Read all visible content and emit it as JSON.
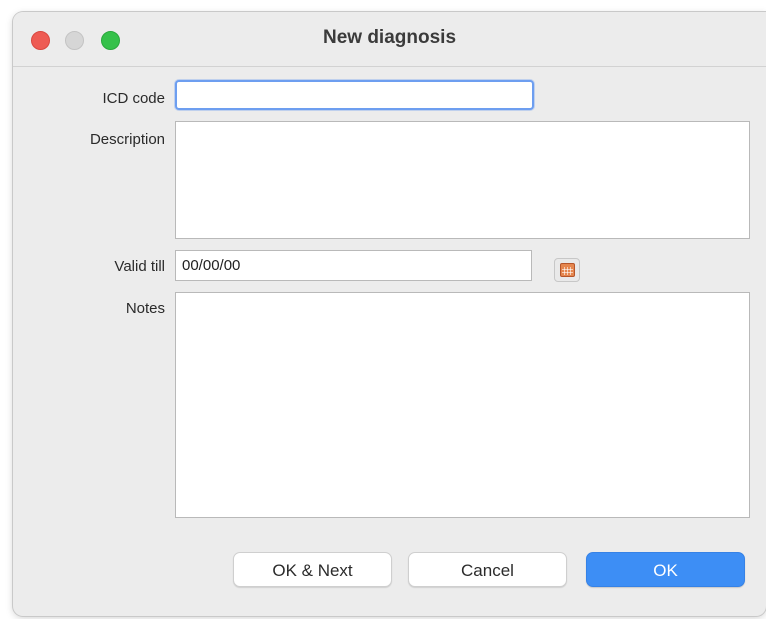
{
  "window": {
    "title": "New diagnosis"
  },
  "form": {
    "icd_code": {
      "label": "ICD code",
      "value": ""
    },
    "description": {
      "label": "Description",
      "value": ""
    },
    "valid_till": {
      "label": "Valid till",
      "value": "00/00/00"
    },
    "notes": {
      "label": "Notes",
      "value": ""
    }
  },
  "buttons": {
    "ok_next": "OK & Next",
    "cancel": "Cancel",
    "ok": "OK"
  },
  "icons": {
    "close": "close-icon",
    "minimize": "minimize-icon",
    "zoom": "zoom-icon",
    "calendar": "calendar-icon"
  },
  "colors": {
    "primary_button": "#3d8ef5",
    "focus_ring": "#6d9ef0",
    "close": "#ee5b53",
    "zoom": "#35c14a"
  }
}
